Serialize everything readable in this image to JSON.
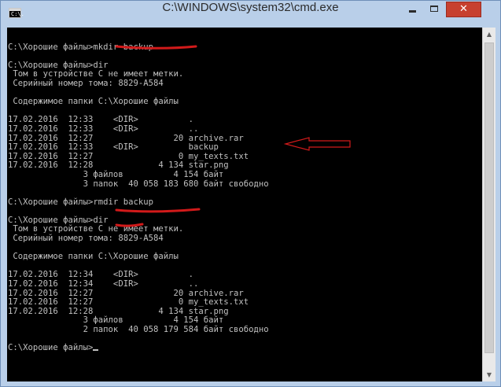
{
  "window": {
    "title": "C:\\WINDOWS\\system32\\cmd.exe",
    "icon_text": "C:\\.",
    "close_label": "✕"
  },
  "console": {
    "lines": [
      "",
      "C:\\Хорошие файлы>mkdir backup",
      "",
      "C:\\Хорошие файлы>dir",
      " Том в устройстве C не имеет метки.",
      " Серийный номер тома: 8829-A584",
      "",
      " Содержимое папки C:\\Хорошие файлы",
      "",
      "17.02.2016  12:33    <DIR>          .",
      "17.02.2016  12:33    <DIR>          ..",
      "17.02.2016  12:27                20 archive.rar",
      "17.02.2016  12:33    <DIR>          backup",
      "17.02.2016  12:27                 0 my_texts.txt",
      "17.02.2016  12:28             4 134 star.png",
      "               3 файлов          4 154 байт",
      "               3 папок  40 058 183 680 байт свободно",
      "",
      "C:\\Хорошие файлы>rmdir backup",
      "",
      "C:\\Хорошие файлы>dir",
      " Том в устройстве C не имеет метки.",
      " Серийный номер тома: 8829-A584",
      "",
      " Содержимое папки C:\\Хорошие файлы",
      "",
      "17.02.2016  12:34    <DIR>          .",
      "17.02.2016  12:34    <DIR>          ..",
      "17.02.2016  12:27                20 archive.rar",
      "17.02.2016  12:27                 0 my_texts.txt",
      "17.02.2016  12:28             4 134 star.png",
      "               3 файлов          4 154 байт",
      "               2 папок  40 058 179 584 байт свободно",
      "",
      "C:\\Хорошие файлы>"
    ]
  },
  "colors": {
    "console_background": "#000000",
    "console_text": "#c0c0c0",
    "annotation_red": "#d11a1a",
    "titlebar": "#b9cfe9",
    "close_button": "#c7402f"
  },
  "icons": {
    "app": "cmd-icon",
    "minimize": "minimize-icon",
    "maximize": "maximize-icon",
    "close": "close-icon",
    "scroll_up": "arrow-up-icon",
    "scroll_down": "arrow-down-icon"
  }
}
